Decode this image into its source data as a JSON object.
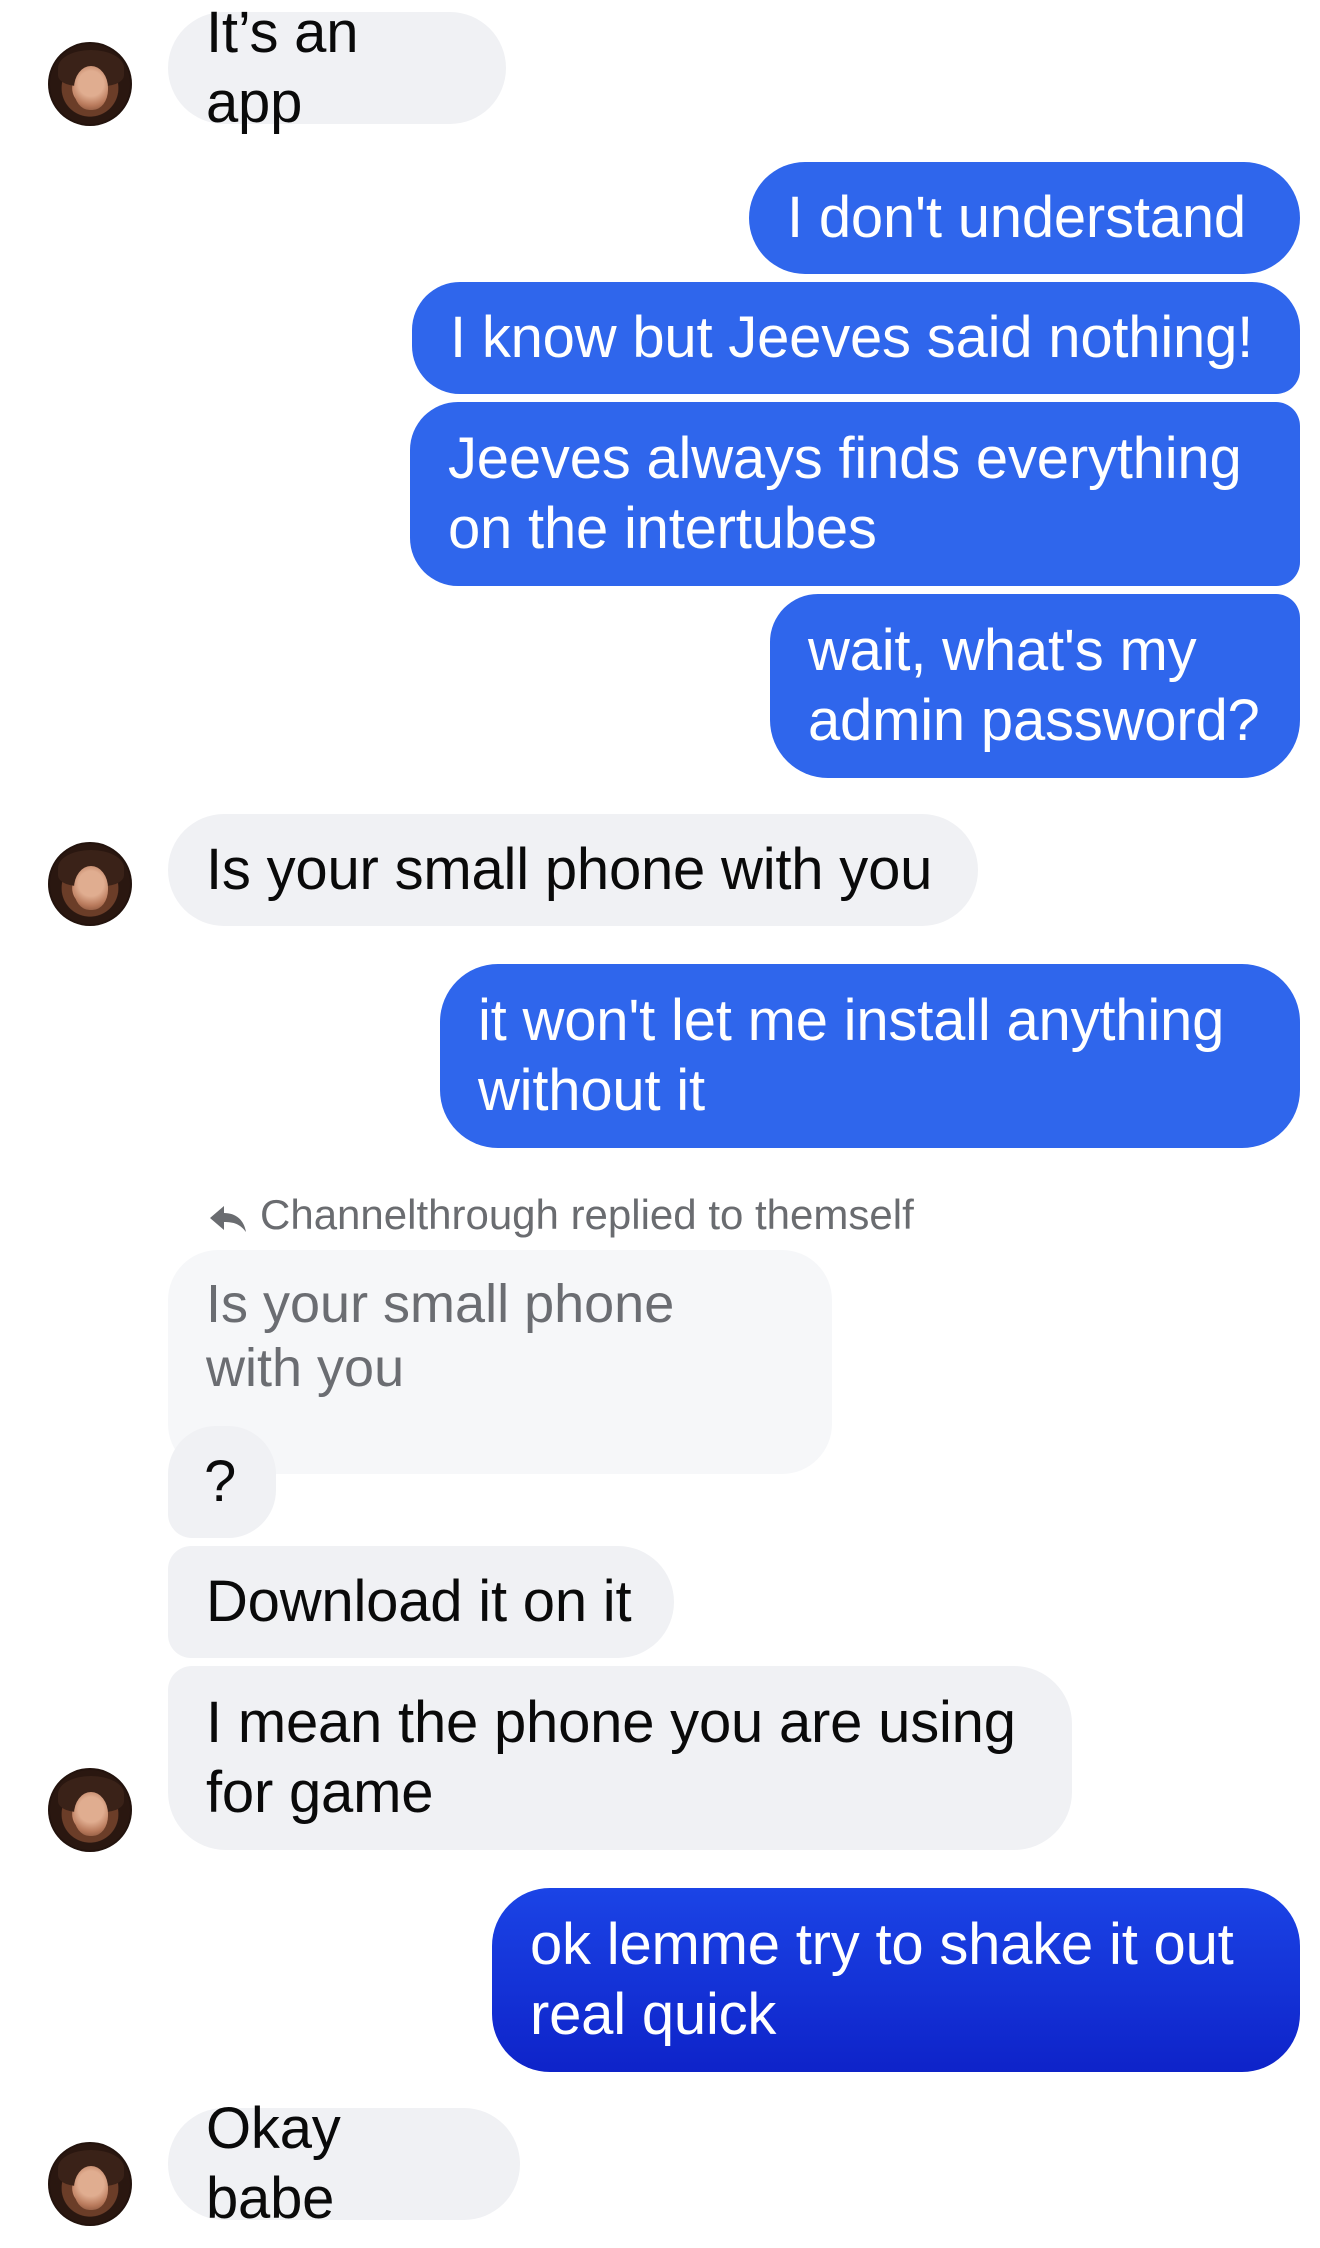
{
  "messages": [
    {
      "text": "It’s an app"
    },
    {
      "text": "I don't understand"
    },
    {
      "text": "I know but Jeeves said nothing!"
    },
    {
      "text": "Jeeves always finds everything\non the intertubes"
    },
    {
      "text": "wait, what's my\nadmin password?"
    },
    {
      "text": "Is your small phone with you"
    },
    {
      "text": "it won't let me install anything\nwithout it"
    },
    {
      "text": "?"
    },
    {
      "text": "Download it on it"
    },
    {
      "text": "I mean the phone you are using\nfor game"
    },
    {
      "text": "ok lemme try to shake it out\nreal quick"
    },
    {
      "text": "Okay babe"
    }
  ],
  "reply": {
    "note": "Channelthrough replied to themself",
    "quoted_text": "Is your small phone\nwith you",
    "icon": "reply-arrow-icon"
  },
  "contact": {
    "avatar_icon": "contact-avatar"
  },
  "colors": {
    "incoming_bubble": "#f0f1f4",
    "outgoing_bubble": "#2f66ec",
    "outgoing_bubble_latest": "#1b44e6",
    "quoted_bubble": "#f6f7f9"
  }
}
